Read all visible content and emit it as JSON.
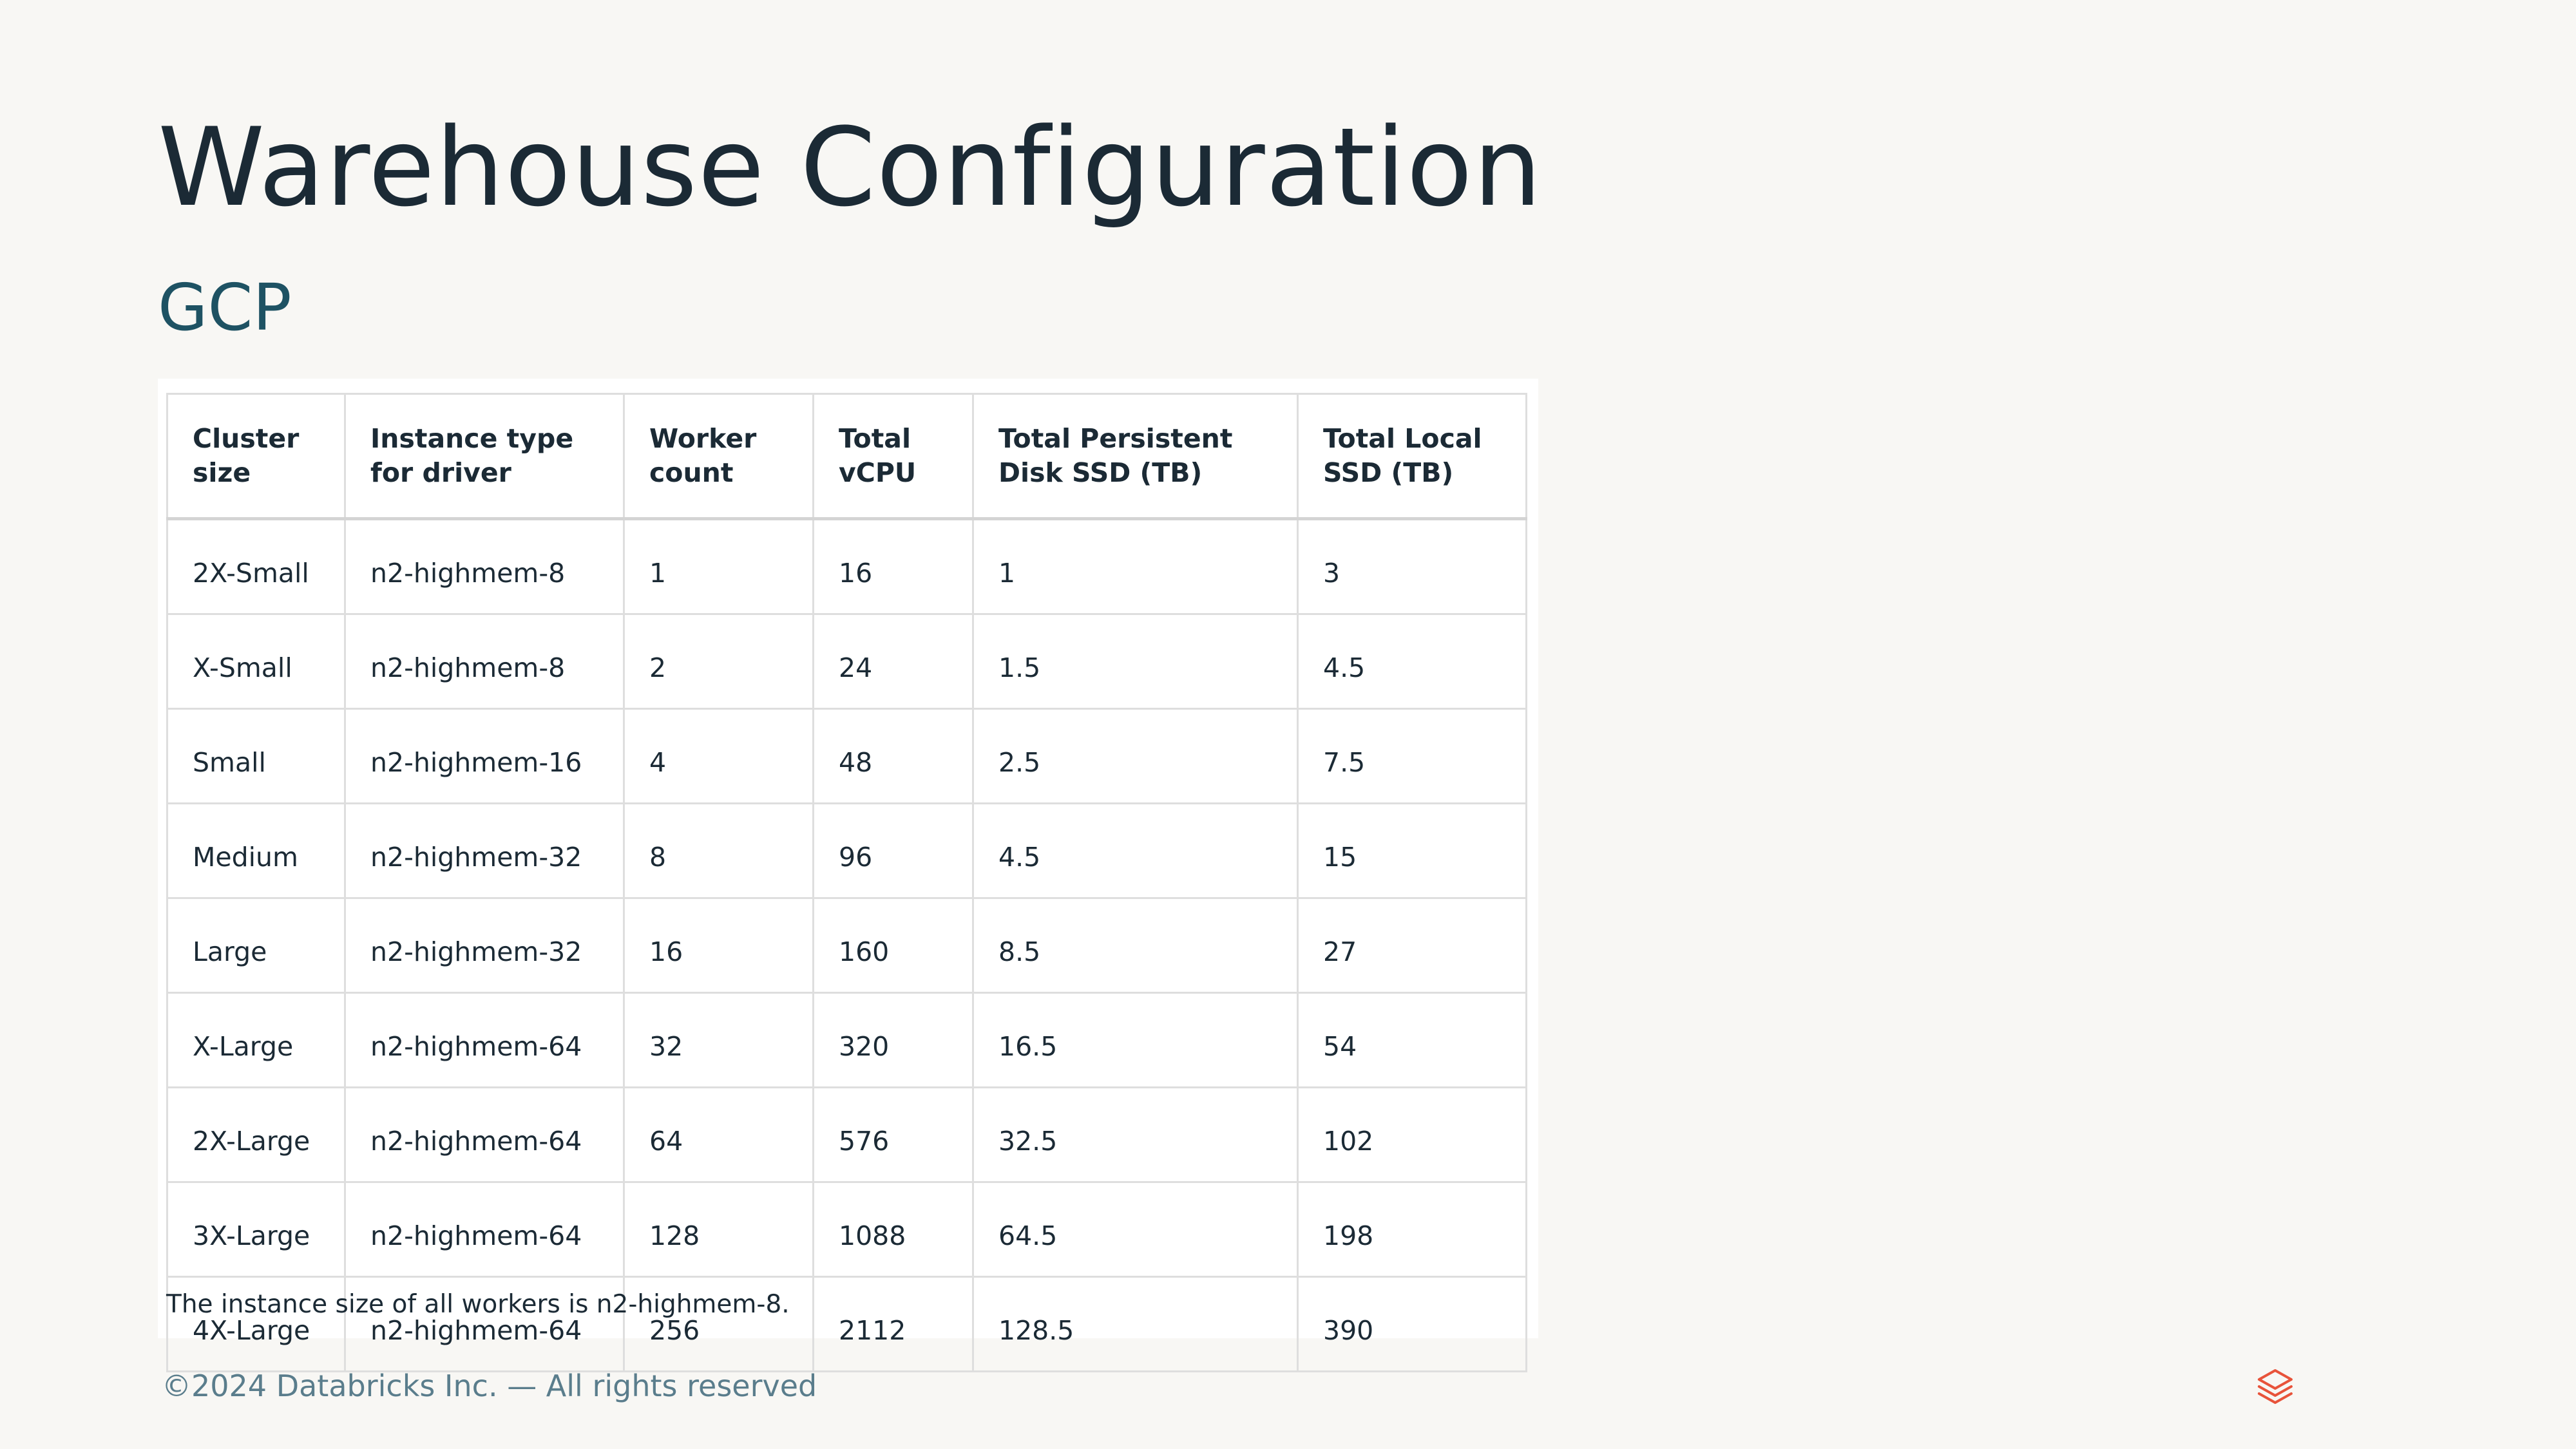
{
  "slide": {
    "title": "Warehouse Configuration",
    "subtitle": "GCP",
    "footer": "©2024 Databricks Inc. — All rights reserved",
    "logo_icon": "databricks-stacked-layers-icon",
    "accent_color": "#e8533a"
  },
  "table": {
    "headers": [
      "Cluster size",
      "Instance type for driver",
      "Worker count",
      "Total vCPU",
      "Total Persistent Disk SSD (TB)",
      "Total Local SSD (TB)"
    ],
    "rows": [
      [
        "2X-Small",
        "n2-highmem-8",
        "1",
        "16",
        "1",
        "3"
      ],
      [
        "X-Small",
        "n2-highmem-8",
        "2",
        "24",
        "1.5",
        "4.5"
      ],
      [
        "Small",
        "n2-highmem-16",
        "4",
        "48",
        "2.5",
        "7.5"
      ],
      [
        "Medium",
        "n2-highmem-32",
        "8",
        "96",
        "4.5",
        "15"
      ],
      [
        "Large",
        "n2-highmem-32",
        "16",
        "160",
        "8.5",
        "27"
      ],
      [
        "X-Large",
        "n2-highmem-64",
        "32",
        "320",
        "16.5",
        "54"
      ],
      [
        "2X-Large",
        "n2-highmem-64",
        "64",
        "576",
        "32.5",
        "102"
      ],
      [
        "3X-Large",
        "n2-highmem-64",
        "128",
        "1088",
        "64.5",
        "198"
      ],
      [
        "4X-Large",
        "n2-highmem-64",
        "256",
        "2112",
        "128.5",
        "390"
      ]
    ],
    "note": "The instance size of all workers is n2-highmem-8."
  }
}
